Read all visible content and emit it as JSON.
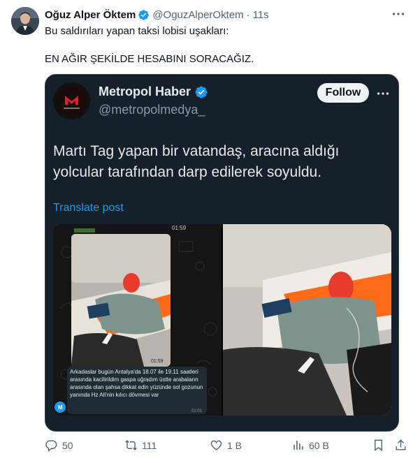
{
  "author": {
    "name": "Oğuz Alper Öktem",
    "handle": "@OguzAlperOktem",
    "separator": "·",
    "time": "11s"
  },
  "tweet": {
    "line1": "Bu saldırıları yapan taksi lobisi uşakları:",
    "line2": "EN AĞIR ŞEKİLDE HESABINI SORACAĞIZ."
  },
  "quote": {
    "name": "Metropol Haber",
    "handle": "@metropolmedya_",
    "follow_label": "Follow",
    "text": "Martı Tag yapan bir vatandaş, aracına aldığı yolcular tarafından darp edilerek soyuldu.",
    "translate_label": "Translate post",
    "media": {
      "left_timestamp_top": "01:59",
      "left_timestamp_inner": "01:59",
      "chat_message": "Arkadaslar bugün Antalya'da 18.07 ile 19.11 saatleri arasında kacilirildim gaspa uğradım üstte arabaların arasında olan şahsa dikkat edin yüzünde sol gozunun yanında Hz Ali'nin kılıcı dövmesi var",
      "chat_time": "02:01",
      "chat_avatar_letter": "M"
    }
  },
  "actions": {
    "replies": "50",
    "reposts": "111",
    "likes": "1 B",
    "views": "60 B"
  },
  "colors": {
    "verified": "#1d9bf0",
    "quote_bg": "#15202b",
    "link": "#1d9bf0"
  },
  "icons": [
    "verified-badge-icon",
    "more-icon",
    "reply-icon",
    "repost-icon",
    "like-icon",
    "views-icon",
    "bookmark-icon",
    "share-icon"
  ]
}
